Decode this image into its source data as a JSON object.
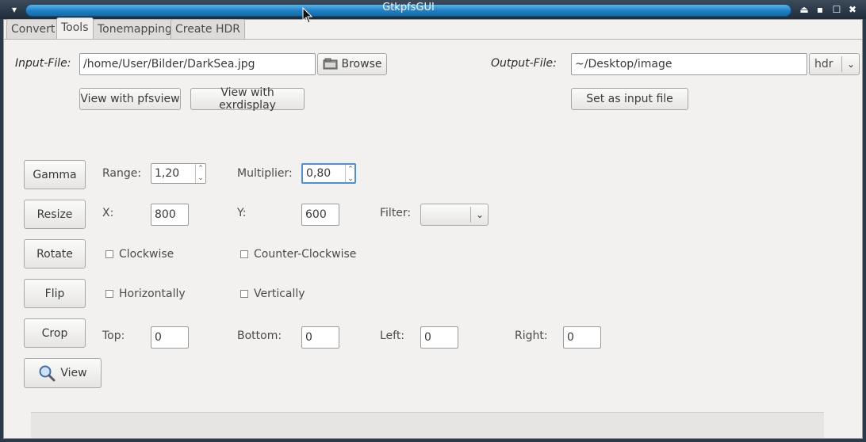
{
  "window": {
    "title": "GtkpfsGUI"
  },
  "tabs": [
    {
      "label": "Convert",
      "active": false
    },
    {
      "label": "Tools",
      "active": true
    },
    {
      "label": "Tonemapping",
      "active": false
    },
    {
      "label": "Create HDR",
      "active": false
    }
  ],
  "input_file": {
    "label": "Input-File:",
    "value": "/home/User/Bilder/DarkSea.jpg",
    "browse_label": "Browse",
    "view_pfsview_label": "View with pfsview",
    "view_exrdisplay_label": "View with exrdisplay"
  },
  "output_file": {
    "label": "Output-File:",
    "value": "~/Desktop/image",
    "format": "hdr",
    "set_input_label": "Set as input file"
  },
  "gamma": {
    "button": "Gamma",
    "range_label": "Range:",
    "range_value": "1,20",
    "multiplier_label": "Multiplier:",
    "multiplier_value": "0,80"
  },
  "resize": {
    "button": "Resize",
    "x_label": "X:",
    "x_value": "800",
    "y_label": "Y:",
    "y_value": "600",
    "filter_label": "Filter:",
    "filter_value": ""
  },
  "rotate": {
    "button": "Rotate",
    "cw_label": "Clockwise",
    "ccw_label": "Counter-Clockwise"
  },
  "flip": {
    "button": "Flip",
    "h_label": "Horizontally",
    "v_label": "Vertically"
  },
  "crop": {
    "button": "Crop",
    "top_label": "Top:",
    "top_value": "0",
    "bottom_label": "Bottom:",
    "bottom_value": "0",
    "left_label": "Left:",
    "left_value": "0",
    "right_label": "Right:",
    "right_value": "0"
  },
  "view": {
    "button": "View"
  }
}
